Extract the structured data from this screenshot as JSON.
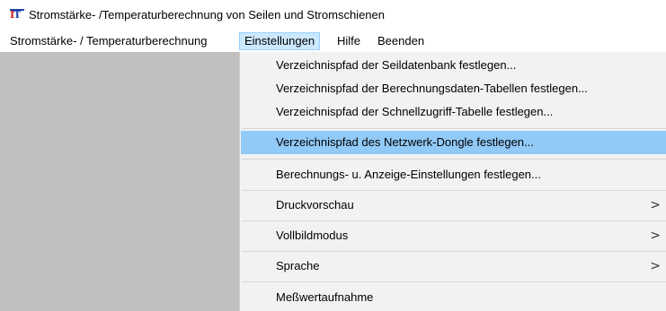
{
  "window": {
    "title": "Stromstärke- /Temperaturberechnung von Seilen und Stromschienen",
    "icon": "app-logo-icon",
    "icon_text": "IT"
  },
  "menubar": {
    "items": [
      {
        "label": "Stromstärke- / Temperaturberechnung",
        "active": false
      },
      {
        "label": "Einstellungen",
        "active": true
      },
      {
        "label": "Hilfe",
        "active": false
      },
      {
        "label": "Beenden",
        "active": false
      }
    ]
  },
  "dropdown": {
    "items": [
      {
        "label": "Verzeichnispfad der Seildatenbank festlegen...",
        "submenu": false,
        "highlighted": false
      },
      {
        "label": "Verzeichnispfad der Berechnungsdaten-Tabellen festlegen...",
        "submenu": false,
        "highlighted": false
      },
      {
        "label": "Verzeichnispfad der Schnellzugriff-Tabelle festlegen...",
        "submenu": false,
        "highlighted": false
      },
      {
        "label": "Verzeichnispfad des Netzwerk-Dongle festlegen...",
        "submenu": false,
        "highlighted": true
      },
      {
        "label": "Berechnungs- u. Anzeige-Einstellungen festlegen...",
        "submenu": false,
        "highlighted": false
      },
      {
        "label": "Druckvorschau",
        "submenu": true,
        "highlighted": false
      },
      {
        "label": "Vollbildmodus",
        "submenu": true,
        "highlighted": false
      },
      {
        "label": "Sprache",
        "submenu": true,
        "highlighted": false
      },
      {
        "label": "Meßwertaufnahme",
        "submenu": false,
        "highlighted": false
      }
    ],
    "submenu_arrow": ">"
  },
  "colors": {
    "client_background": "#c0c0c0",
    "menu_background": "#f2f2f2",
    "highlight": "#91c9f7",
    "active_menu": "#cce8ff"
  }
}
